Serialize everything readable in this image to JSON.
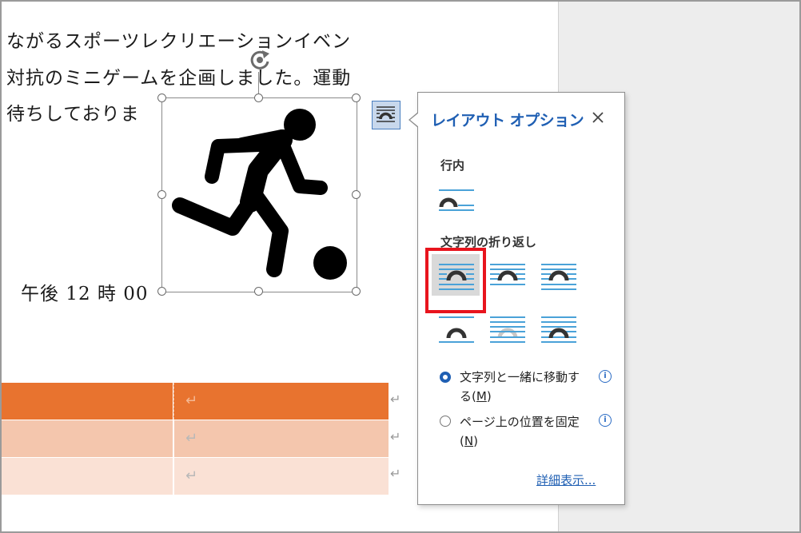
{
  "document": {
    "lines": [
      "ながるスポーツレクリエーションイベン",
      "対抗のミニゲームを企画しました。運動",
      "待ちしておりま",
      "午後 12 時 00"
    ],
    "table_colors": {
      "header": "#e8732f",
      "row2": "#f4c6ad",
      "row3": "#fae1d5"
    },
    "cell_mark": "↵",
    "row_end_mark": "↵"
  },
  "layout_options": {
    "title": "レイアウト オプション",
    "close_label": "✕",
    "inline_label": "行内",
    "wrap_label": "文字列の折り返し",
    "radio_move": {
      "line1": "文字列と一緒に移動す",
      "line2_pre": "る(",
      "key": "M",
      "line2_post": ")"
    },
    "radio_fixed": {
      "line1": "ページ上の位置を固定",
      "line2_pre": "(",
      "key": "N",
      "line2_post": ")"
    },
    "info_glyph": "i",
    "details_link": "詳細表示..."
  },
  "icons": {
    "figure": "soccer-player-icon",
    "rotate": "rotate-handle-icon",
    "layout_button": "layout-options-icon",
    "close": "close-icon"
  },
  "colors": {
    "accent": "#1f5fb3",
    "highlight": "#e8141d",
    "wrap_blue": "#4aa2d8"
  }
}
